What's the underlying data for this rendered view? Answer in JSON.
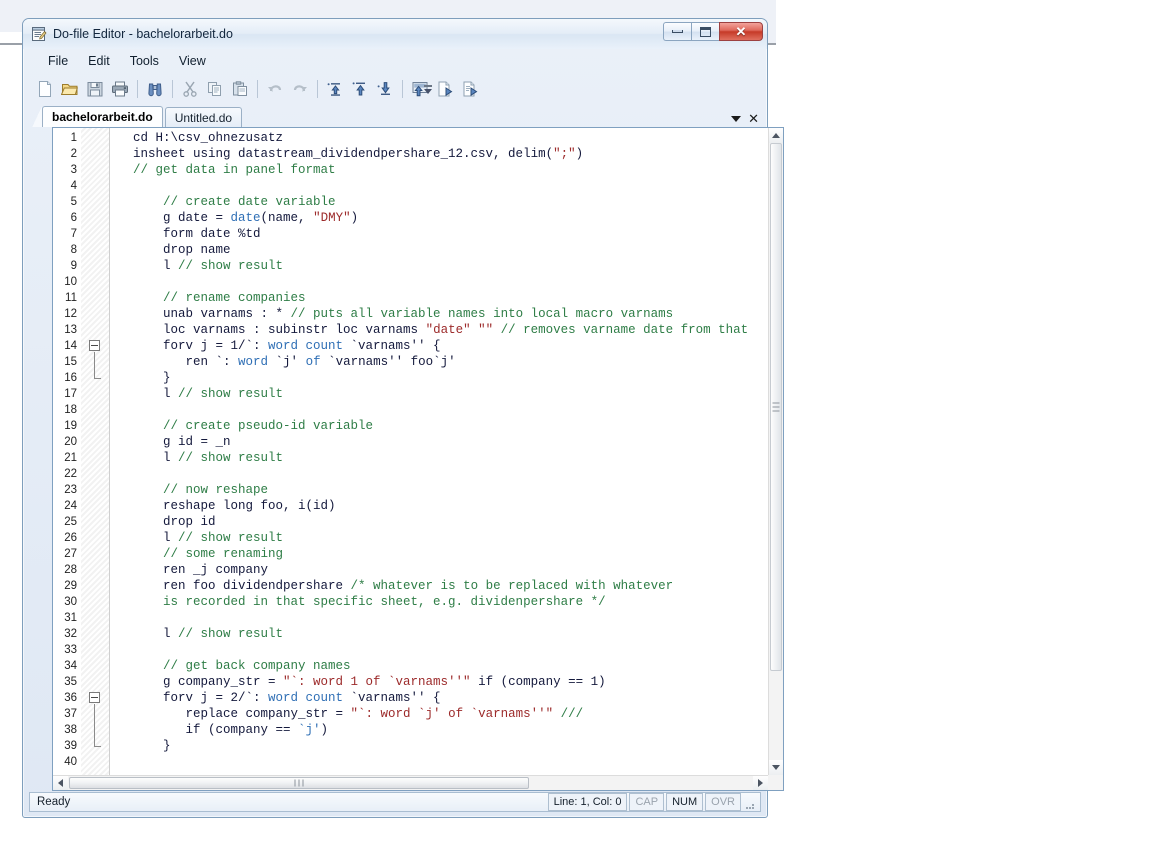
{
  "window": {
    "title": "Do-file Editor - bacheloarbeit.do",
    "title_text": "Do-file Editor - bachelorarbeit.do",
    "icon": "do-file-editor-icon",
    "controls": {
      "minimize": "Minimize",
      "maximize": "Restore",
      "close": "Close"
    }
  },
  "menubar": {
    "items": [
      {
        "label": "File"
      },
      {
        "label": "Edit"
      },
      {
        "label": "Tools"
      },
      {
        "label": "View"
      }
    ]
  },
  "toolbar": {
    "buttons": [
      {
        "name": "new-icon",
        "tip": "New"
      },
      {
        "name": "open-folder-icon",
        "tip": "Open"
      },
      {
        "name": "save-icon",
        "tip": "Save"
      },
      {
        "name": "print-icon",
        "tip": "Print"
      },
      {
        "name": "find-binoculars-icon",
        "tip": "Find"
      },
      {
        "name": "cut-scissors-icon",
        "tip": "Cut"
      },
      {
        "name": "copy-icon",
        "tip": "Copy"
      },
      {
        "name": "paste-icon",
        "tip": "Paste"
      },
      {
        "name": "undo-icon",
        "tip": "Undo"
      },
      {
        "name": "redo-icon",
        "tip": "Redo"
      },
      {
        "name": "execute-quietly-icon",
        "tip": "Execute (quietly)"
      },
      {
        "name": "execute-do-icon",
        "tip": "Do"
      },
      {
        "name": "execute-run-icon",
        "tip": "Run"
      },
      {
        "name": "do-selection-icon",
        "tip": "Do selection"
      },
      {
        "name": "new-document-run-icon",
        "tip": "Run document"
      },
      {
        "name": "do-file-icon",
        "tip": "Do file"
      }
    ],
    "overflow_label": "More buttons"
  },
  "tabs": {
    "items": [
      {
        "label": "bachelorarbeit.do",
        "active": true
      },
      {
        "label": "Untitled.do",
        "active": false
      }
    ],
    "dropdown": "tab-list-dropdown",
    "close": "close-tab"
  },
  "editor": {
    "first_line": 1,
    "lines": [
      {
        "n": 1,
        "segments": [
          {
            "t": "cd H:\\csv_ohnezusatz",
            "c": "kw"
          }
        ]
      },
      {
        "n": 2,
        "segments": [
          {
            "t": "insheet using datastream_dividendpershare_12.csv, delim(",
            "c": "kw"
          },
          {
            "t": "\";\"",
            "c": "str"
          },
          {
            "t": ")",
            "c": "kw"
          }
        ]
      },
      {
        "n": 3,
        "segments": [
          {
            "t": "// get data in panel format",
            "c": "cmt"
          }
        ]
      },
      {
        "n": 4,
        "segments": []
      },
      {
        "n": 5,
        "segments": [
          {
            "t": "    ",
            "c": "kw"
          },
          {
            "t": "// create date variable",
            "c": "cmt"
          }
        ]
      },
      {
        "n": 6,
        "segments": [
          {
            "t": "    g date = ",
            "c": "kw"
          },
          {
            "t": "date",
            "c": "fun"
          },
          {
            "t": "(name, ",
            "c": "kw"
          },
          {
            "t": "\"DMY\"",
            "c": "str"
          },
          {
            "t": ")",
            "c": "kw"
          }
        ]
      },
      {
        "n": 7,
        "segments": [
          {
            "t": "    form date %td",
            "c": "kw"
          }
        ]
      },
      {
        "n": 8,
        "segments": [
          {
            "t": "    drop name",
            "c": "kw"
          }
        ]
      },
      {
        "n": 9,
        "segments": [
          {
            "t": "    l ",
            "c": "kw"
          },
          {
            "t": "// show result",
            "c": "cmt"
          }
        ]
      },
      {
        "n": 10,
        "segments": []
      },
      {
        "n": 11,
        "segments": [
          {
            "t": "    ",
            "c": "kw"
          },
          {
            "t": "// rename companies",
            "c": "cmt"
          }
        ]
      },
      {
        "n": 12,
        "segments": [
          {
            "t": "    unab varnams : * ",
            "c": "kw"
          },
          {
            "t": "// puts all variable names into local macro varnams",
            "c": "cmt"
          }
        ]
      },
      {
        "n": 13,
        "segments": [
          {
            "t": "    loc varnams : subinstr loc varnams ",
            "c": "kw"
          },
          {
            "t": "\"date\" \"\"",
            "c": "str"
          },
          {
            "t": " ",
            "c": "kw"
          },
          {
            "t": "// removes varname date from that",
            "c": "cmt"
          }
        ]
      },
      {
        "n": 14,
        "segments": [
          {
            "t": "    forv j = 1/`: ",
            "c": "kw"
          },
          {
            "t": "word count",
            "c": "fun"
          },
          {
            "t": " `varnams'' {",
            "c": "kw"
          }
        ],
        "fold": "start"
      },
      {
        "n": 15,
        "segments": [
          {
            "t": "       ren `: ",
            "c": "kw"
          },
          {
            "t": "word",
            "c": "fun"
          },
          {
            "t": " `j' ",
            "c": "kw"
          },
          {
            "t": "of",
            "c": "fun"
          },
          {
            "t": " `varnams'' foo`j'",
            "c": "kw"
          }
        ],
        "fold": "mid"
      },
      {
        "n": 16,
        "segments": [
          {
            "t": "    }",
            "c": "kw"
          }
        ],
        "fold": "end"
      },
      {
        "n": 17,
        "segments": [
          {
            "t": "    l ",
            "c": "kw"
          },
          {
            "t": "// show result",
            "c": "cmt"
          }
        ]
      },
      {
        "n": 18,
        "segments": []
      },
      {
        "n": 19,
        "segments": [
          {
            "t": "    ",
            "c": "kw"
          },
          {
            "t": "// create pseudo-id variable",
            "c": "cmt"
          }
        ]
      },
      {
        "n": 20,
        "segments": [
          {
            "t": "    g id = _n",
            "c": "kw"
          }
        ]
      },
      {
        "n": 21,
        "segments": [
          {
            "t": "    l ",
            "c": "kw"
          },
          {
            "t": "// show result",
            "c": "cmt"
          }
        ]
      },
      {
        "n": 22,
        "segments": []
      },
      {
        "n": 23,
        "segments": [
          {
            "t": "    ",
            "c": "kw"
          },
          {
            "t": "// now reshape",
            "c": "cmt"
          }
        ]
      },
      {
        "n": 24,
        "segments": [
          {
            "t": "    reshape long foo, i(id)",
            "c": "kw"
          }
        ]
      },
      {
        "n": 25,
        "segments": [
          {
            "t": "    drop id",
            "c": "kw"
          }
        ]
      },
      {
        "n": 26,
        "segments": [
          {
            "t": "    l ",
            "c": "kw"
          },
          {
            "t": "// show result",
            "c": "cmt"
          }
        ]
      },
      {
        "n": 27,
        "segments": [
          {
            "t": "    ",
            "c": "kw"
          },
          {
            "t": "// some renaming",
            "c": "cmt"
          }
        ]
      },
      {
        "n": 28,
        "segments": [
          {
            "t": "    ren _j company",
            "c": "kw"
          }
        ]
      },
      {
        "n": 29,
        "segments": [
          {
            "t": "    ren foo dividendpershare ",
            "c": "kw"
          },
          {
            "t": "/* whatever is to be replaced with whatever",
            "c": "cmt"
          }
        ]
      },
      {
        "n": 30,
        "segments": [
          {
            "t": "    is recorded in that specific sheet, e.g. dividenpershare */",
            "c": "cmt"
          }
        ]
      },
      {
        "n": 31,
        "segments": []
      },
      {
        "n": 32,
        "segments": [
          {
            "t": "    l ",
            "c": "kw"
          },
          {
            "t": "// show result",
            "c": "cmt"
          }
        ]
      },
      {
        "n": 33,
        "segments": []
      },
      {
        "n": 34,
        "segments": [
          {
            "t": "    ",
            "c": "kw"
          },
          {
            "t": "// get back company names",
            "c": "cmt"
          }
        ]
      },
      {
        "n": 35,
        "segments": [
          {
            "t": "    g company_str = ",
            "c": "kw"
          },
          {
            "t": "\"`: word 1 of `varnams''\"",
            "c": "str"
          },
          {
            "t": " if (company == 1)",
            "c": "kw"
          }
        ]
      },
      {
        "n": 36,
        "segments": [
          {
            "t": "    forv j = 2/`: ",
            "c": "kw"
          },
          {
            "t": "word count",
            "c": "fun"
          },
          {
            "t": " `varnams'' {",
            "c": "kw"
          }
        ],
        "fold": "start"
      },
      {
        "n": 37,
        "segments": [
          {
            "t": "       replace company_str = ",
            "c": "kw"
          },
          {
            "t": "\"`: word `j' of `varnams''\"",
            "c": "str"
          },
          {
            "t": " ",
            "c": "kw"
          },
          {
            "t": "///",
            "c": "cmt"
          }
        ],
        "fold": "mid"
      },
      {
        "n": 38,
        "segments": [
          {
            "t": "       if (company == ",
            "c": "kw"
          },
          {
            "t": "`j'",
            "c": "fun"
          },
          {
            "t": ")",
            "c": "kw"
          }
        ],
        "fold": "mid"
      },
      {
        "n": 39,
        "segments": [
          {
            "t": "    }",
            "c": "kw"
          }
        ],
        "fold": "end"
      },
      {
        "n": 40,
        "segments": []
      }
    ]
  },
  "statusbar": {
    "message": "Ready",
    "position": "Line: 1, Col: 0",
    "indicators": [
      {
        "label": "CAP",
        "active": false
      },
      {
        "label": "NUM",
        "active": true
      },
      {
        "label": "OVR",
        "active": false
      }
    ],
    "resize_grip": "resize-grip"
  },
  "colors": {
    "comment": "#2e7d46",
    "string": "#9c2a2a",
    "function": "#2f6fb5",
    "code": "#14193c",
    "close_button": "#c63a28",
    "frame": "#7e9ebc"
  }
}
